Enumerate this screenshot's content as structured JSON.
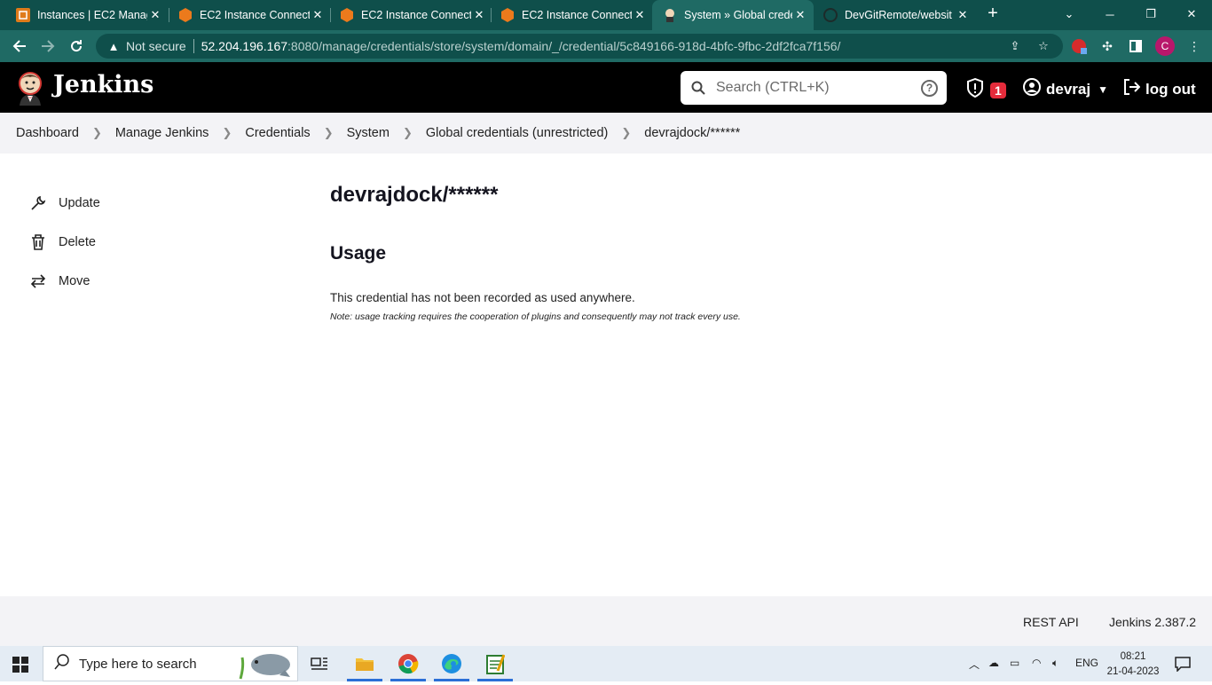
{
  "browser": {
    "tabs": [
      {
        "title": "Instances | EC2 Manag",
        "icon": "aws-instances-icon",
        "active": false
      },
      {
        "title": "EC2 Instance Connect",
        "icon": "aws-ec2-icon",
        "active": false
      },
      {
        "title": "EC2 Instance Connect",
        "icon": "aws-ec2-icon",
        "active": false
      },
      {
        "title": "EC2 Instance Connect",
        "icon": "aws-ec2-icon",
        "active": false
      },
      {
        "title": "System » Global crede",
        "icon": "jenkins-icon",
        "active": true
      },
      {
        "title": "DevGitRemote/websit",
        "icon": "github-icon",
        "active": false
      }
    ],
    "security_label": "Not secure",
    "url_host": "52.204.196.167",
    "url_path": ":8080/manage/credentials/store/system/domain/_/credential/5c849166-918d-4bfc-9fbc-2df2fca7f156/",
    "profile_initial": "C",
    "theme_colors": {
      "tabstrip": "#0f4f4b",
      "toolbar": "#1f6a64"
    }
  },
  "jenkins": {
    "brand": "Jenkins",
    "search_placeholder": "Search (CTRL+K)",
    "security_alert_count": "1",
    "user": "devraj",
    "logout_label": "log out",
    "breadcrumbs": [
      "Dashboard",
      "Manage Jenkins",
      "Credentials",
      "System",
      "Global credentials (unrestricted)",
      "devrajdock/******"
    ],
    "sidebar": [
      {
        "label": "Update",
        "icon": "wrench-icon"
      },
      {
        "label": "Delete",
        "icon": "trash-icon"
      },
      {
        "label": "Move",
        "icon": "move-arrows-icon"
      }
    ],
    "main": {
      "title": "devrajdock/******",
      "section_heading": "Usage",
      "message": "This credential has not been recorded as used anywhere.",
      "note": "Note: usage tracking requires the cooperation of plugins and consequently may not track every use."
    },
    "footer": {
      "rest_api": "REST API",
      "version": "Jenkins 2.387.2"
    },
    "accent_colors": {
      "header": "#000000",
      "badge": "#e52b3b",
      "breadcrumb_bg": "#f3f3f6"
    }
  },
  "taskbar": {
    "search_placeholder": "Type here to search",
    "language": "ENG",
    "time": "08:21",
    "date": "21-04-2023"
  }
}
